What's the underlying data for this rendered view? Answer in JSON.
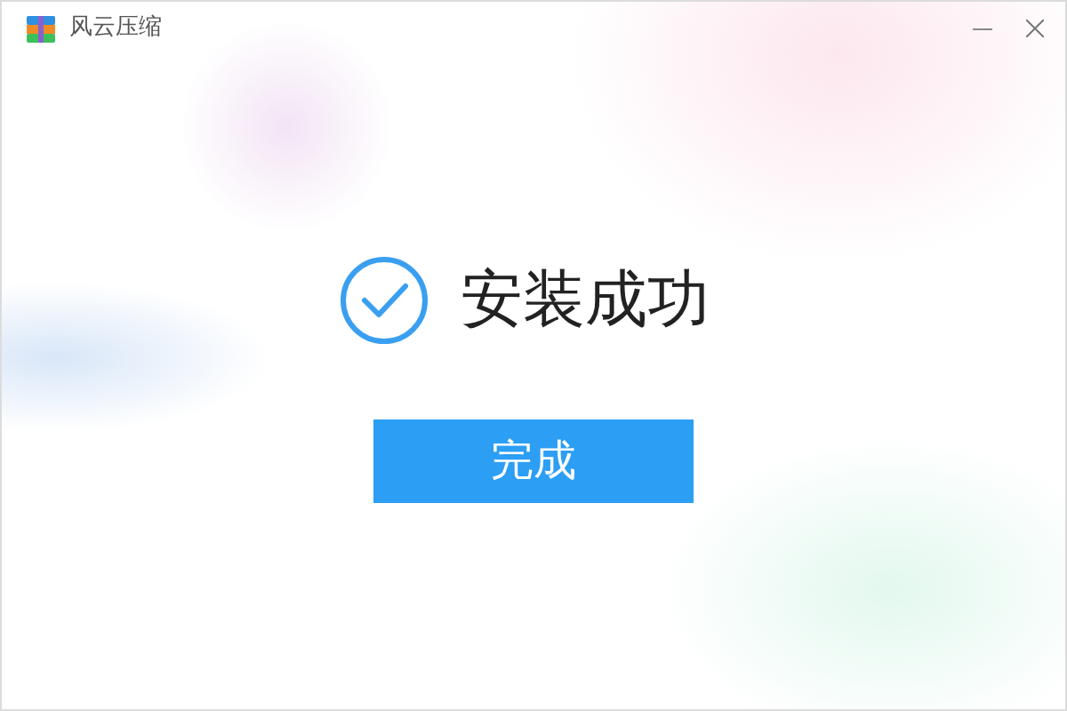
{
  "window": {
    "title": "风云压缩"
  },
  "message": "安装成功",
  "buttons": [
    "完成"
  ]
}
